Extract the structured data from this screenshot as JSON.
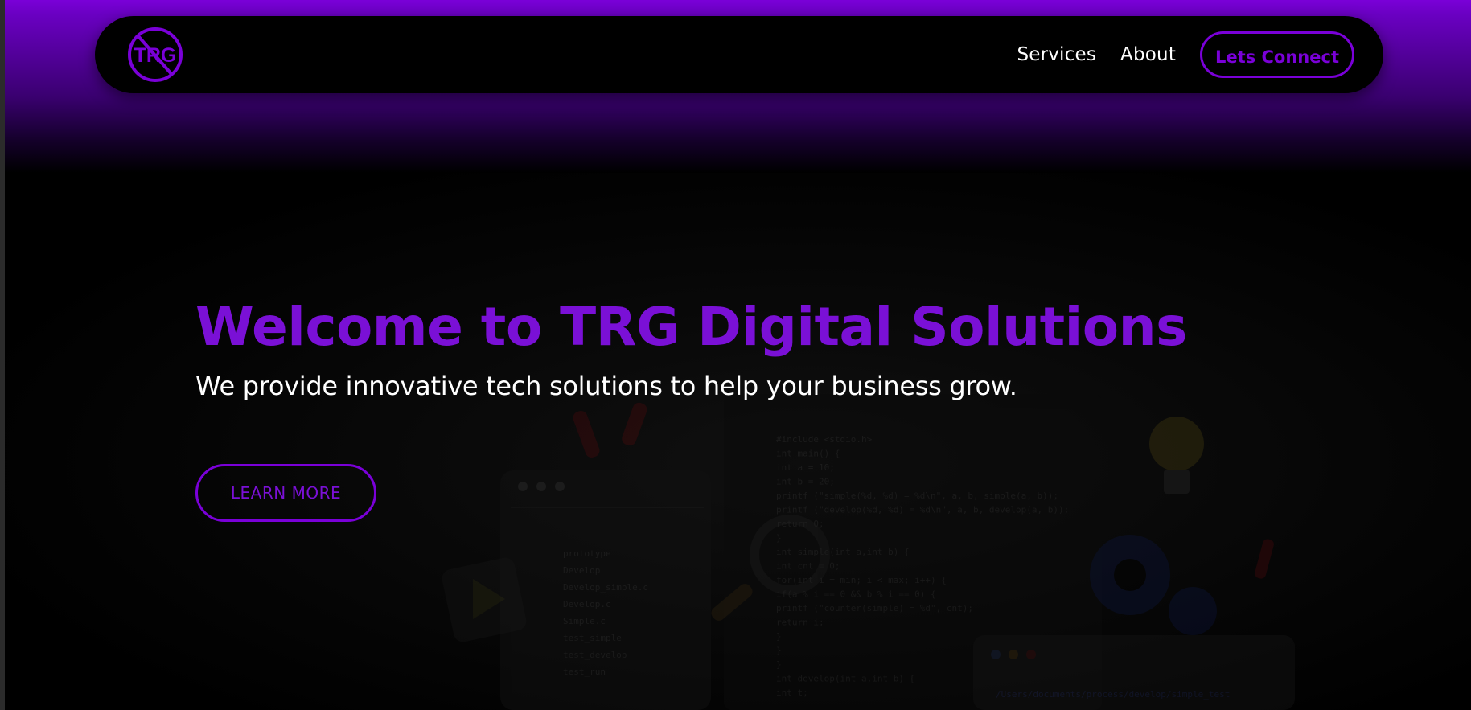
{
  "brand": {
    "logo_text": "TRG",
    "accent_color": "#7a00d8"
  },
  "nav": {
    "links": [
      "Services",
      "About"
    ],
    "cta_label": "Lets Connect"
  },
  "hero": {
    "title": "Welcome to TRG Digital Solutions",
    "subtitle": "We provide innovative tech solutions to help your business grow.",
    "button_label": "LEARN MORE"
  },
  "illustration": {
    "folder_tree": [
      "prototype",
      "Develop",
      "Develop_simple.c",
      "Develop.c",
      "Simple.c",
      "test_simple",
      "test_develop",
      "test_run"
    ],
    "code_lines": [
      "#include <stdio.h>",
      "int main() {",
      "int a = 10;",
      "int b = 20;",
      "printf (\"simple(%d, %d) = %d\\n\", a, b, simple(a, b));",
      "printf (\"develop(%d, %d) = %d\\n\", a, b, develop(a, b));",
      "return 0;",
      "}",
      "int simple(int a,int b) {",
      "int cnt = 0;",
      "for(int i = min; i < max; i++) {",
      "if(a % i == 0 && b % i == 0) {",
      "printf (\"counter(simple) = %d\", cnt);",
      "return i;",
      "}",
      "}",
      "}",
      "int develop(int a,int b) {",
      "int t;"
    ],
    "path": "/Users/documents/process/develop/simple_test"
  }
}
